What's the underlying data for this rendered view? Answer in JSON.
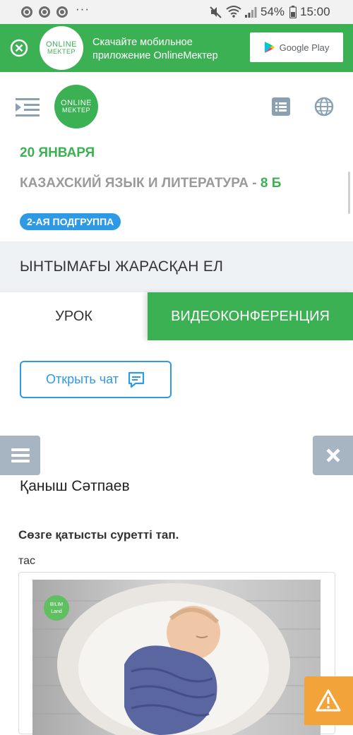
{
  "status_bar": {
    "battery": "54%",
    "time": "15:00",
    "more": "···"
  },
  "banner": {
    "logo_line1": "ONLINE",
    "logo_line2": "MEKTEP",
    "text": "Скачайте мобильное приложение OnlineMектеp",
    "store_label": "Google Play"
  },
  "header": {
    "logo_line1": "ONLINE",
    "logo_line2": "MEKTEP",
    "date": "20 ЯНВАРЯ",
    "subject": "КАЗАХСКИЙ ЯЗЫК И ЛИТЕРАТУРА -",
    "class": "8 Б",
    "subgroup": "2-АЯ ПОДГРУППА"
  },
  "topic": "ЫНТЫМАҒЫ ЖАРАСҚАН ЕЛ",
  "tabs": [
    {
      "label": "УРОК",
      "active": false
    },
    {
      "label": "ВИДЕОКОНФЕРЕНЦИЯ",
      "active": true
    }
  ],
  "chat_button": "Открыть чат",
  "content": {
    "author": "Қаныш Сәтпаев",
    "question": "Сөзге қатысты суретті тап.",
    "word": "тас",
    "image_logo_line1": "BILIM",
    "image_logo_line2": "Land"
  },
  "colors": {
    "brand_green": "#3cb154",
    "accent_blue": "#2e9ae6",
    "muted_gray": "#a7b5c2",
    "warning_orange": "#f2a33a"
  },
  "icons": [
    "chrome-icon",
    "mute-icon",
    "wifi-icon",
    "signal-icon",
    "close-circle-icon",
    "google-play-icon",
    "menu-toggle-icon",
    "list-icon",
    "globe-icon",
    "chat-icon",
    "hamburger-icon",
    "close-icon",
    "warning-icon"
  ]
}
